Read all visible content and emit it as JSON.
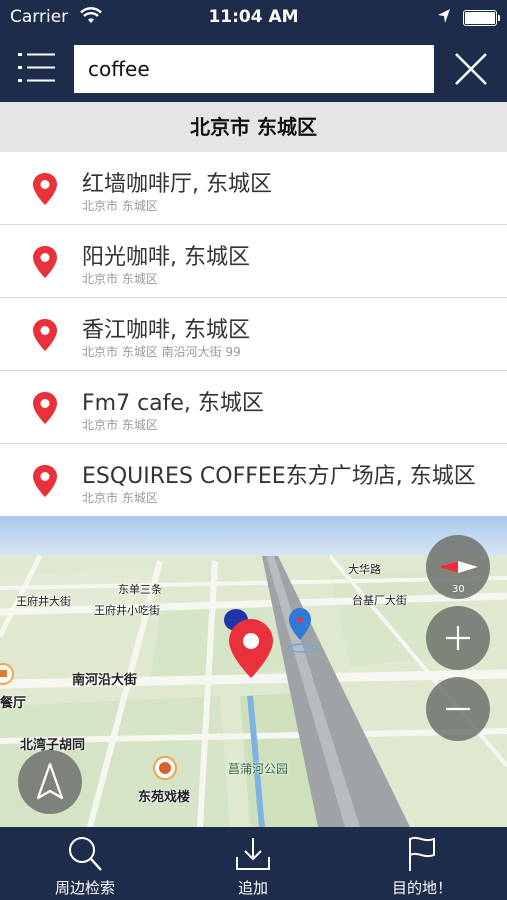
{
  "status_bar": {
    "carrier": "Carrier",
    "time": "11:04 AM"
  },
  "search": {
    "value": "coffee"
  },
  "region": "北京市 东城区",
  "results": [
    {
      "title": "红墙咖啡厅, 东城区",
      "subtitle": "北京市 东城区"
    },
    {
      "title": "阳光咖啡, 东城区",
      "subtitle": "北京市 东城区"
    },
    {
      "title": "香江咖啡, 东城区",
      "subtitle": "北京市 东城区 南沿河大街 99"
    },
    {
      "title": "Fm7 cafe, 东城区",
      "subtitle": "北京市 东城区"
    },
    {
      "title": "ESQUIRES COFFEE东方广场店, 东城区",
      "subtitle": "北京市 东城区"
    }
  ],
  "map": {
    "labels": {
      "dongdan": "东单三条",
      "wangfujing_st": "王府井大街",
      "wangfujing_lane": "王府井小吃街",
      "dahua": "大华路",
      "taiji": "台基厂大街",
      "nanheyan": "南河沿大街",
      "restaurant": "餐厅",
      "beiwanzi": "北湾子胡同",
      "park": "菖蒲河公园",
      "theatre": "东苑戏楼",
      "compass": "30"
    }
  },
  "toolbar": {
    "nearby": "周边检索",
    "add": "追加",
    "destination": "目的地！"
  },
  "colors": {
    "nav": "#1e2c4b",
    "pin": "#e8313a",
    "accent_blue": "#2f7ad6"
  }
}
